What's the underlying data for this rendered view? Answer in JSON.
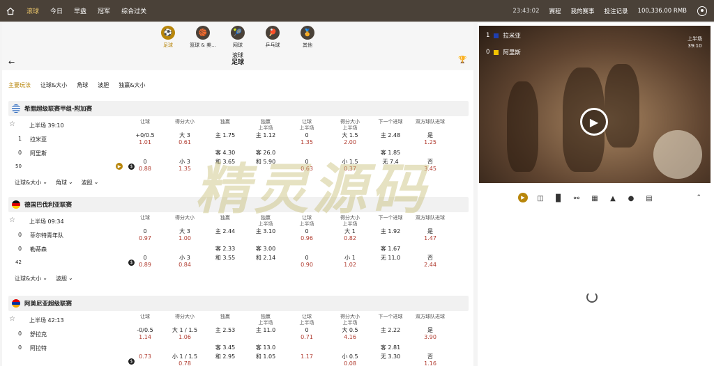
{
  "nav": {
    "tabs": [
      "滚球",
      "今日",
      "早盘",
      "冠军",
      "综合过关"
    ],
    "clock": "23:43:02",
    "links": [
      "赛程",
      "我的赛事",
      "投注记录"
    ],
    "balance": "100,336.00 RMB"
  },
  "sports": [
    {
      "label": "足球",
      "icon": "⚽"
    },
    {
      "label": "篮球 & 美...",
      "icon": "🏀"
    },
    {
      "label": "网球",
      "icon": "🎾"
    },
    {
      "label": "乒乓球",
      "icon": "🏓"
    },
    {
      "label": "其他",
      "icon": "🏅"
    }
  ],
  "title": {
    "top": "滚球",
    "main": "足球"
  },
  "markets": [
    "主要玩法",
    "让球&大小",
    "角球",
    "波胆",
    "独赢&大小"
  ],
  "columns": [
    "让球",
    "得分大小",
    "独赢",
    "独赢\n上半场",
    "让球\n上半场",
    "得分大小\n上半场",
    "下一个进球",
    "双方球队进球"
  ],
  "leagues": [
    {
      "name": "希腊超级联赛甲组-附加赛",
      "flag": "gr",
      "status": "上半场 39:10",
      "home": {
        "score": "1",
        "name": "拉米亚"
      },
      "away": {
        "score": "0",
        "name": "阿里斯"
      },
      "count": "50",
      "row1": [
        [
          "+0/0.5",
          "1.01"
        ],
        [
          "大 3",
          "0.61"
        ],
        [
          "主 1.75",
          ""
        ],
        [
          "主 1.12",
          ""
        ],
        [
          "0",
          "1.35"
        ],
        [
          "大 1.5",
          "2.00"
        ],
        [
          "主 2.48",
          ""
        ],
        [
          "是",
          "1.25"
        ]
      ],
      "row2": [
        "",
        "",
        "客 4.30",
        "客 26.0",
        "",
        "",
        "客 1.85",
        ""
      ],
      "row3": [
        [
          "0",
          "0.88"
        ],
        [
          "小 3",
          "1.35"
        ],
        [
          "和 3.65",
          ""
        ],
        [
          "和 5.90",
          ""
        ],
        [
          "0",
          "0.63"
        ],
        [
          "小 1.5",
          "0.37"
        ],
        [
          "无 7.4",
          ""
        ],
        [
          "否",
          "3.45"
        ]
      ],
      "more": [
        "让球&大小",
        "角球",
        "波胆"
      ]
    },
    {
      "name": "德国巴伐利亚联赛",
      "flag": "de",
      "status": "上半场 09:34",
      "home": {
        "score": "0",
        "name": "菲尔特青年队"
      },
      "away": {
        "score": "0",
        "name": "勒蒂森"
      },
      "count": "42",
      "row1": [
        [
          "0",
          "0.97"
        ],
        [
          "大 3",
          "1.00"
        ],
        [
          "主 2.44",
          ""
        ],
        [
          "主 3.10",
          ""
        ],
        [
          "0",
          "0.96"
        ],
        [
          "大 1",
          "0.82"
        ],
        [
          "主 1.92",
          ""
        ],
        [
          "是",
          "1.47"
        ]
      ],
      "row2": [
        "",
        "",
        "客 2.33",
        "客 3.00",
        "",
        "",
        "客 1.67",
        ""
      ],
      "row3": [
        [
          "0",
          "0.89"
        ],
        [
          "小 3",
          "0.84"
        ],
        [
          "和 3.55",
          ""
        ],
        [
          "和 2.14",
          ""
        ],
        [
          "0",
          "0.90"
        ],
        [
          "小 1",
          "1.02"
        ],
        [
          "无 11.0",
          ""
        ],
        [
          "否",
          "2.44"
        ]
      ],
      "more": [
        "让球&大小",
        "波胆"
      ]
    },
    {
      "name": "阿美尼亚超级联赛",
      "flag": "am",
      "status": "上半场 42:13",
      "home": {
        "score": "0",
        "name": "舒拉克"
      },
      "away": {
        "score": "0",
        "name": "阿拉特"
      },
      "count": "",
      "row1": [
        [
          "-0/0.5",
          "1.14"
        ],
        [
          "大 1 / 1.5",
          "1.06"
        ],
        [
          "主 2.53",
          ""
        ],
        [
          "主 11.0",
          ""
        ],
        [
          "0",
          "0.71"
        ],
        [
          "大 0.5",
          "4.16"
        ],
        [
          "主 2.22",
          ""
        ],
        [
          "是",
          "3.90"
        ]
      ],
      "row2": [
        "",
        "",
        "客 3.45",
        "客 13.0",
        "",
        "",
        "客 2.81",
        ""
      ],
      "row3": [
        [
          "",
          "0.73"
        ],
        [
          "小 1 / 1.5",
          "0.78"
        ],
        [
          "和 2.95",
          ""
        ],
        [
          "和 1.05",
          ""
        ],
        [
          "",
          "1.17"
        ],
        [
          "小 0.5",
          "0.08"
        ],
        [
          "无 3.30",
          ""
        ],
        [
          "否",
          "1.16"
        ]
      ],
      "more": []
    }
  ],
  "video": {
    "home": {
      "score": "1",
      "name": "拉米亚",
      "color": "#1f3fb0"
    },
    "away": {
      "score": "0",
      "name": "阿里斯",
      "color": "#f2c400"
    },
    "status": "上半场",
    "time": "39:10"
  },
  "watermark": "精灵源码"
}
